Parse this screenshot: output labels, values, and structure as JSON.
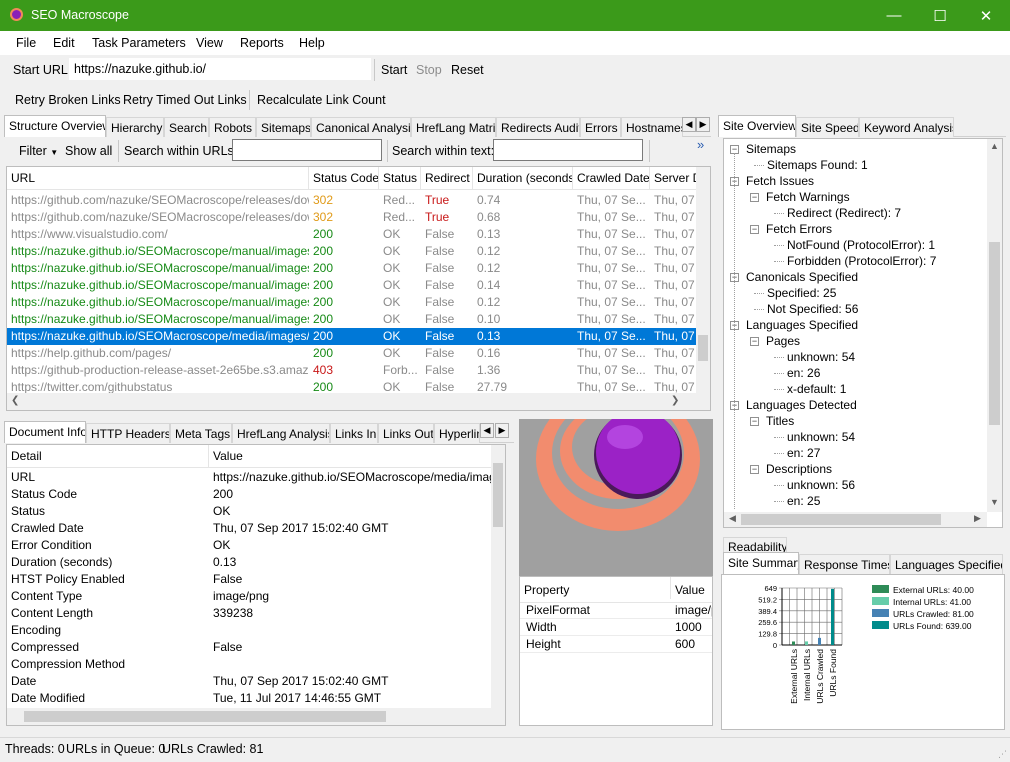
{
  "window": {
    "title": "SEO Macroscope",
    "minimize": "—",
    "maximize": "☐",
    "close": "✕"
  },
  "menu": [
    "File",
    "Edit",
    "Task Parameters",
    "View",
    "Reports",
    "Help"
  ],
  "url_bar": {
    "label": "Start URL:",
    "value": "https://nazuke.github.io/",
    "start": "Start",
    "stop": "Stop",
    "reset": "Reset"
  },
  "actions": {
    "retry_broken": "Retry Broken Links",
    "retry_timed_out": "Retry Timed Out Links",
    "recalculate": "Recalculate Link Count"
  },
  "main_tabs": [
    "Structure Overview",
    "Hierarchy",
    "Search",
    "Robots",
    "Sitemaps",
    "Canonical Analysis",
    "HrefLang Matrix",
    "Redirects Audit",
    "Errors",
    "Hostnames"
  ],
  "filter_bar": {
    "filter": "Filter",
    "show_all": "Show all",
    "search_urls_label": "Search within URLs:",
    "search_text_label": "Search within text:",
    "overflow": "»"
  },
  "url_table": {
    "columns": [
      "URL",
      "Status Code",
      "Status",
      "Redirect",
      "Duration (seconds)",
      "Crawled Date",
      "Server D"
    ],
    "rows": [
      {
        "url": "https://github.com/nazuke/SEOMacroscope/releases/dow...",
        "code": "302",
        "status": "Red...",
        "redirect": "True",
        "duration": "0.74",
        "date": "Thu, 07 Se...",
        "server": "Thu, 07",
        "tone": "orange"
      },
      {
        "url": "https://github.com/nazuke/SEOMacroscope/releases/dow...",
        "code": "302",
        "status": "Red...",
        "redirect": "True",
        "duration": "0.68",
        "date": "Thu, 07 Se...",
        "server": "Thu, 07",
        "tone": "orange"
      },
      {
        "url": "https://www.visualstudio.com/",
        "code": "200",
        "status": "OK",
        "redirect": "False",
        "duration": "0.13",
        "date": "Thu, 07 Se...",
        "server": "Thu, 07",
        "tone": "gray"
      },
      {
        "url": "https://nazuke.github.io/SEOMacroscope/manual/images/...",
        "code": "200",
        "status": "OK",
        "redirect": "False",
        "duration": "0.12",
        "date": "Thu, 07 Se...",
        "server": "Thu, 07",
        "tone": "green"
      },
      {
        "url": "https://nazuke.github.io/SEOMacroscope/manual/images/...",
        "code": "200",
        "status": "OK",
        "redirect": "False",
        "duration": "0.12",
        "date": "Thu, 07 Se...",
        "server": "Thu, 07",
        "tone": "green"
      },
      {
        "url": "https://nazuke.github.io/SEOMacroscope/manual/images/...",
        "code": "200",
        "status": "OK",
        "redirect": "False",
        "duration": "0.14",
        "date": "Thu, 07 Se...",
        "server": "Thu, 07",
        "tone": "green"
      },
      {
        "url": "https://nazuke.github.io/SEOMacroscope/manual/images/...",
        "code": "200",
        "status": "OK",
        "redirect": "False",
        "duration": "0.12",
        "date": "Thu, 07 Se...",
        "server": "Thu, 07",
        "tone": "green"
      },
      {
        "url": "https://nazuke.github.io/SEOMacroscope/manual/images/...",
        "code": "200",
        "status": "OK",
        "redirect": "False",
        "duration": "0.10",
        "date": "Thu, 07 Se...",
        "server": "Thu, 07",
        "tone": "green"
      },
      {
        "url": "https://nazuke.github.io/SEOMacroscope/media/images/j...",
        "code": "200",
        "status": "OK",
        "redirect": "False",
        "duration": "0.13",
        "date": "Thu, 07 Se...",
        "server": "Thu, 07",
        "tone": "selected"
      },
      {
        "url": "https://help.github.com/pages/",
        "code": "200",
        "status": "OK",
        "redirect": "False",
        "duration": "0.16",
        "date": "Thu, 07 Se...",
        "server": "Thu, 07",
        "tone": "gray"
      },
      {
        "url": "https://github-production-release-asset-2e65be.s3.amazona...",
        "code": "403",
        "status": "Forb...",
        "redirect": "False",
        "duration": "1.36",
        "date": "Thu, 07 Se...",
        "server": "Thu, 07",
        "tone": "red"
      },
      {
        "url": "https://twitter.com/githubstatus",
        "code": "200",
        "status": "OK",
        "redirect": "False",
        "duration": "27.79",
        "date": "Thu, 07 Se...",
        "server": "Thu, 07",
        "tone": "gray"
      }
    ]
  },
  "detail_tabs": [
    "Document Info",
    "HTTP Headers",
    "Meta Tags",
    "HrefLang Analysis",
    "Links In",
    "Links Out",
    "Hyperlin"
  ],
  "detail_table": {
    "columns": [
      "Detail",
      "Value"
    ],
    "rows": [
      {
        "k": "URL",
        "v": "https://nazuke.github.io/SEOMacroscope/media/images/j"
      },
      {
        "k": "Status Code",
        "v": "200"
      },
      {
        "k": "Status",
        "v": "OK"
      },
      {
        "k": "Crawled Date",
        "v": "Thu, 07 Sep 2017 15:02:40 GMT"
      },
      {
        "k": "Error Condition",
        "v": "OK"
      },
      {
        "k": "Duration (seconds)",
        "v": "0.13"
      },
      {
        "k": "HTST Policy Enabled",
        "v": "False"
      },
      {
        "k": "Content Type",
        "v": "image/png"
      },
      {
        "k": "Content Length",
        "v": "339238"
      },
      {
        "k": "Encoding",
        "v": ""
      },
      {
        "k": "Compressed",
        "v": "False"
      },
      {
        "k": "Compression Method",
        "v": ""
      },
      {
        "k": "Date",
        "v": "Thu, 07 Sep 2017 15:02:40 GMT"
      },
      {
        "k": "Date Modified",
        "v": "Tue, 11 Jul 2017 14:46:55 GMT"
      }
    ]
  },
  "image_props": {
    "columns": [
      "Property",
      "Value"
    ],
    "rows": [
      {
        "k": "PixelFormat",
        "v": "image/p"
      },
      {
        "k": "Width",
        "v": "1000"
      },
      {
        "k": "Height",
        "v": "600"
      }
    ]
  },
  "right_tabs": [
    "Site Overview",
    "Site Speed",
    "Keyword Analysis"
  ],
  "site_tree": [
    {
      "depth": 0,
      "label": "Sitemaps",
      "box": "−"
    },
    {
      "depth": 1,
      "label": "Sitemaps Found: 1",
      "box": ""
    },
    {
      "depth": 0,
      "label": "Fetch Issues",
      "box": "−"
    },
    {
      "depth": 1,
      "label": "Fetch Warnings",
      "box": "−"
    },
    {
      "depth": 2,
      "label": "Redirect (Redirect): 7",
      "box": ""
    },
    {
      "depth": 1,
      "label": "Fetch Errors",
      "box": "−"
    },
    {
      "depth": 2,
      "label": "NotFound (ProtocolError): 1",
      "box": ""
    },
    {
      "depth": 2,
      "label": "Forbidden (ProtocolError): 7",
      "box": ""
    },
    {
      "depth": 0,
      "label": "Canonicals Specified",
      "box": "−"
    },
    {
      "depth": 1,
      "label": "Specified: 25",
      "box": ""
    },
    {
      "depth": 1,
      "label": "Not Specified: 56",
      "box": ""
    },
    {
      "depth": 0,
      "label": "Languages Specified",
      "box": "−"
    },
    {
      "depth": 1,
      "label": "Pages",
      "box": "−"
    },
    {
      "depth": 2,
      "label": "unknown: 54",
      "box": ""
    },
    {
      "depth": 2,
      "label": "en: 26",
      "box": ""
    },
    {
      "depth": 2,
      "label": "x-default: 1",
      "box": ""
    },
    {
      "depth": 0,
      "label": "Languages Detected",
      "box": "−"
    },
    {
      "depth": 1,
      "label": "Titles",
      "box": "−"
    },
    {
      "depth": 2,
      "label": "unknown: 54",
      "box": ""
    },
    {
      "depth": 2,
      "label": "en: 27",
      "box": ""
    },
    {
      "depth": 1,
      "label": "Descriptions",
      "box": "−"
    },
    {
      "depth": 2,
      "label": "unknown: 56",
      "box": ""
    },
    {
      "depth": 2,
      "label": "en: 25",
      "box": ""
    }
  ],
  "summary_tabs_top": [
    "Readability"
  ],
  "summary_tabs": [
    "Site Summary",
    "Response Times",
    "Languages Specified"
  ],
  "chart_data": {
    "type": "bar",
    "categories": [
      "External URLs",
      "Internal URLs",
      "URLs Crawled",
      "URLs Found"
    ],
    "values": [
      40,
      41,
      81,
      639
    ],
    "yticks": [
      "649",
      "519.2",
      "389.4",
      "259.6",
      "129.8",
      "0"
    ],
    "ylim": [
      0,
      649
    ],
    "legend": [
      "External URLs: 40.00",
      "Internal URLs: 41.00",
      "URLs Crawled: 81.00",
      "URLs Found: 639.00"
    ],
    "colors": [
      "#2e8b57",
      "#66cdaa",
      "#4682b4",
      "#008b8b"
    ]
  },
  "status": {
    "threads": "Threads: 0",
    "queue": "URLs in Queue: 0",
    "crawled": "URLs Crawled: 81"
  }
}
